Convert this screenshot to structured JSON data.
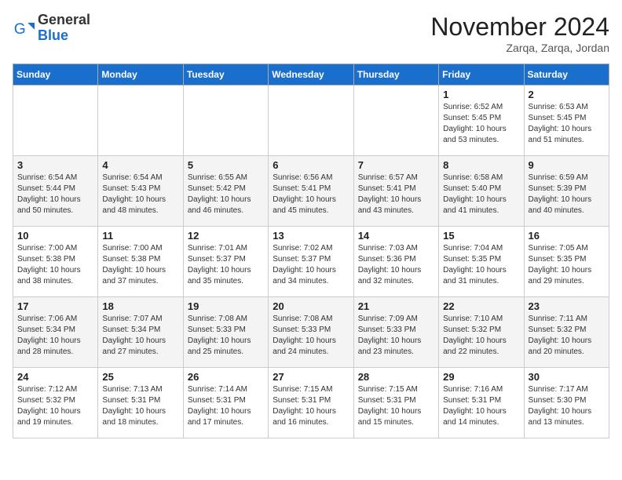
{
  "header": {
    "logo_general": "General",
    "logo_blue": "Blue",
    "month_title": "November 2024",
    "location": "Zarqa, Zarqa, Jordan"
  },
  "weekdays": [
    "Sunday",
    "Monday",
    "Tuesday",
    "Wednesday",
    "Thursday",
    "Friday",
    "Saturday"
  ],
  "weeks": [
    [
      {
        "day": "",
        "info": ""
      },
      {
        "day": "",
        "info": ""
      },
      {
        "day": "",
        "info": ""
      },
      {
        "day": "",
        "info": ""
      },
      {
        "day": "",
        "info": ""
      },
      {
        "day": "1",
        "info": "Sunrise: 6:52 AM\nSunset: 5:45 PM\nDaylight: 10 hours\nand 53 minutes."
      },
      {
        "day": "2",
        "info": "Sunrise: 6:53 AM\nSunset: 5:45 PM\nDaylight: 10 hours\nand 51 minutes."
      }
    ],
    [
      {
        "day": "3",
        "info": "Sunrise: 6:54 AM\nSunset: 5:44 PM\nDaylight: 10 hours\nand 50 minutes."
      },
      {
        "day": "4",
        "info": "Sunrise: 6:54 AM\nSunset: 5:43 PM\nDaylight: 10 hours\nand 48 minutes."
      },
      {
        "day": "5",
        "info": "Sunrise: 6:55 AM\nSunset: 5:42 PM\nDaylight: 10 hours\nand 46 minutes."
      },
      {
        "day": "6",
        "info": "Sunrise: 6:56 AM\nSunset: 5:41 PM\nDaylight: 10 hours\nand 45 minutes."
      },
      {
        "day": "7",
        "info": "Sunrise: 6:57 AM\nSunset: 5:41 PM\nDaylight: 10 hours\nand 43 minutes."
      },
      {
        "day": "8",
        "info": "Sunrise: 6:58 AM\nSunset: 5:40 PM\nDaylight: 10 hours\nand 41 minutes."
      },
      {
        "day": "9",
        "info": "Sunrise: 6:59 AM\nSunset: 5:39 PM\nDaylight: 10 hours\nand 40 minutes."
      }
    ],
    [
      {
        "day": "10",
        "info": "Sunrise: 7:00 AM\nSunset: 5:38 PM\nDaylight: 10 hours\nand 38 minutes."
      },
      {
        "day": "11",
        "info": "Sunrise: 7:00 AM\nSunset: 5:38 PM\nDaylight: 10 hours\nand 37 minutes."
      },
      {
        "day": "12",
        "info": "Sunrise: 7:01 AM\nSunset: 5:37 PM\nDaylight: 10 hours\nand 35 minutes."
      },
      {
        "day": "13",
        "info": "Sunrise: 7:02 AM\nSunset: 5:37 PM\nDaylight: 10 hours\nand 34 minutes."
      },
      {
        "day": "14",
        "info": "Sunrise: 7:03 AM\nSunset: 5:36 PM\nDaylight: 10 hours\nand 32 minutes."
      },
      {
        "day": "15",
        "info": "Sunrise: 7:04 AM\nSunset: 5:35 PM\nDaylight: 10 hours\nand 31 minutes."
      },
      {
        "day": "16",
        "info": "Sunrise: 7:05 AM\nSunset: 5:35 PM\nDaylight: 10 hours\nand 29 minutes."
      }
    ],
    [
      {
        "day": "17",
        "info": "Sunrise: 7:06 AM\nSunset: 5:34 PM\nDaylight: 10 hours\nand 28 minutes."
      },
      {
        "day": "18",
        "info": "Sunrise: 7:07 AM\nSunset: 5:34 PM\nDaylight: 10 hours\nand 27 minutes."
      },
      {
        "day": "19",
        "info": "Sunrise: 7:08 AM\nSunset: 5:33 PM\nDaylight: 10 hours\nand 25 minutes."
      },
      {
        "day": "20",
        "info": "Sunrise: 7:08 AM\nSunset: 5:33 PM\nDaylight: 10 hours\nand 24 minutes."
      },
      {
        "day": "21",
        "info": "Sunrise: 7:09 AM\nSunset: 5:33 PM\nDaylight: 10 hours\nand 23 minutes."
      },
      {
        "day": "22",
        "info": "Sunrise: 7:10 AM\nSunset: 5:32 PM\nDaylight: 10 hours\nand 22 minutes."
      },
      {
        "day": "23",
        "info": "Sunrise: 7:11 AM\nSunset: 5:32 PM\nDaylight: 10 hours\nand 20 minutes."
      }
    ],
    [
      {
        "day": "24",
        "info": "Sunrise: 7:12 AM\nSunset: 5:32 PM\nDaylight: 10 hours\nand 19 minutes."
      },
      {
        "day": "25",
        "info": "Sunrise: 7:13 AM\nSunset: 5:31 PM\nDaylight: 10 hours\nand 18 minutes."
      },
      {
        "day": "26",
        "info": "Sunrise: 7:14 AM\nSunset: 5:31 PM\nDaylight: 10 hours\nand 17 minutes."
      },
      {
        "day": "27",
        "info": "Sunrise: 7:15 AM\nSunset: 5:31 PM\nDaylight: 10 hours\nand 16 minutes."
      },
      {
        "day": "28",
        "info": "Sunrise: 7:15 AM\nSunset: 5:31 PM\nDaylight: 10 hours\nand 15 minutes."
      },
      {
        "day": "29",
        "info": "Sunrise: 7:16 AM\nSunset: 5:31 PM\nDaylight: 10 hours\nand 14 minutes."
      },
      {
        "day": "30",
        "info": "Sunrise: 7:17 AM\nSunset: 5:30 PM\nDaylight: 10 hours\nand 13 minutes."
      }
    ]
  ]
}
